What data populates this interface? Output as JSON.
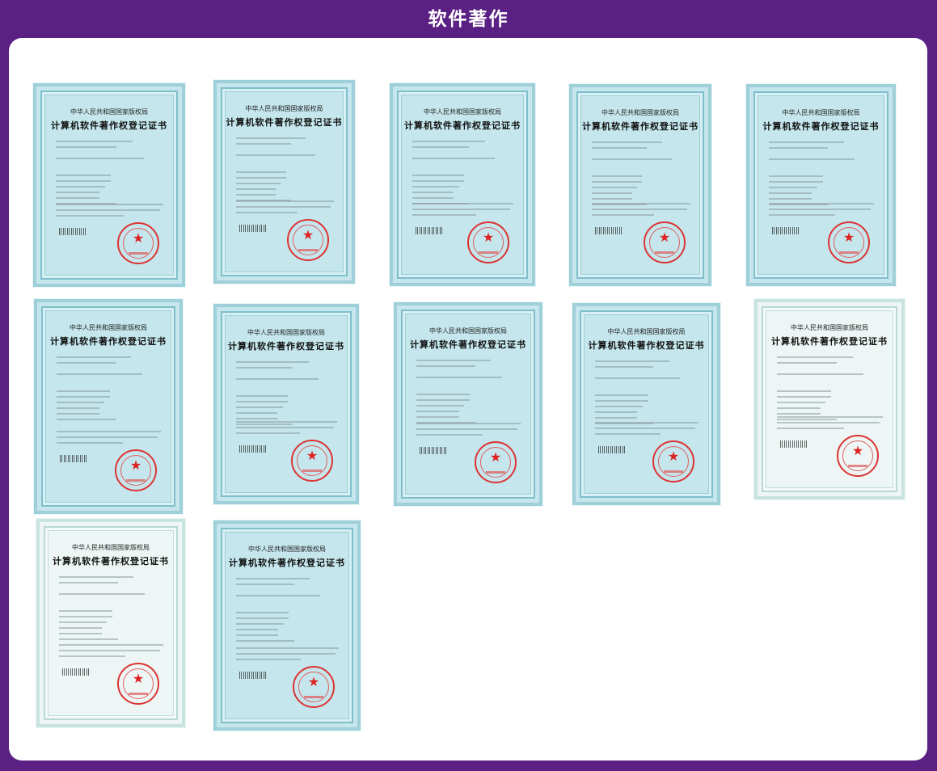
{
  "header": {
    "title": "软件著作"
  },
  "certificate": {
    "issuer": "中华人民共和国国家版权局",
    "heading": "计算机软件著作权登记证书"
  },
  "certificates": [
    {
      "id": 1,
      "style": "blue"
    },
    {
      "id": 2,
      "style": "blue"
    },
    {
      "id": 3,
      "style": "blue"
    },
    {
      "id": 4,
      "style": "blue"
    },
    {
      "id": 5,
      "style": "blue"
    },
    {
      "id": 6,
      "style": "blue"
    },
    {
      "id": 7,
      "style": "blue"
    },
    {
      "id": 8,
      "style": "blue"
    },
    {
      "id": 9,
      "style": "blue"
    },
    {
      "id": 10,
      "style": "plain"
    },
    {
      "id": 11,
      "style": "plain"
    },
    {
      "id": 12,
      "style": "blue"
    }
  ],
  "colors": {
    "background": "#5b2083",
    "panel": "#ffffff",
    "certificate": "#c4e6ec",
    "seal": "#dd2222"
  }
}
